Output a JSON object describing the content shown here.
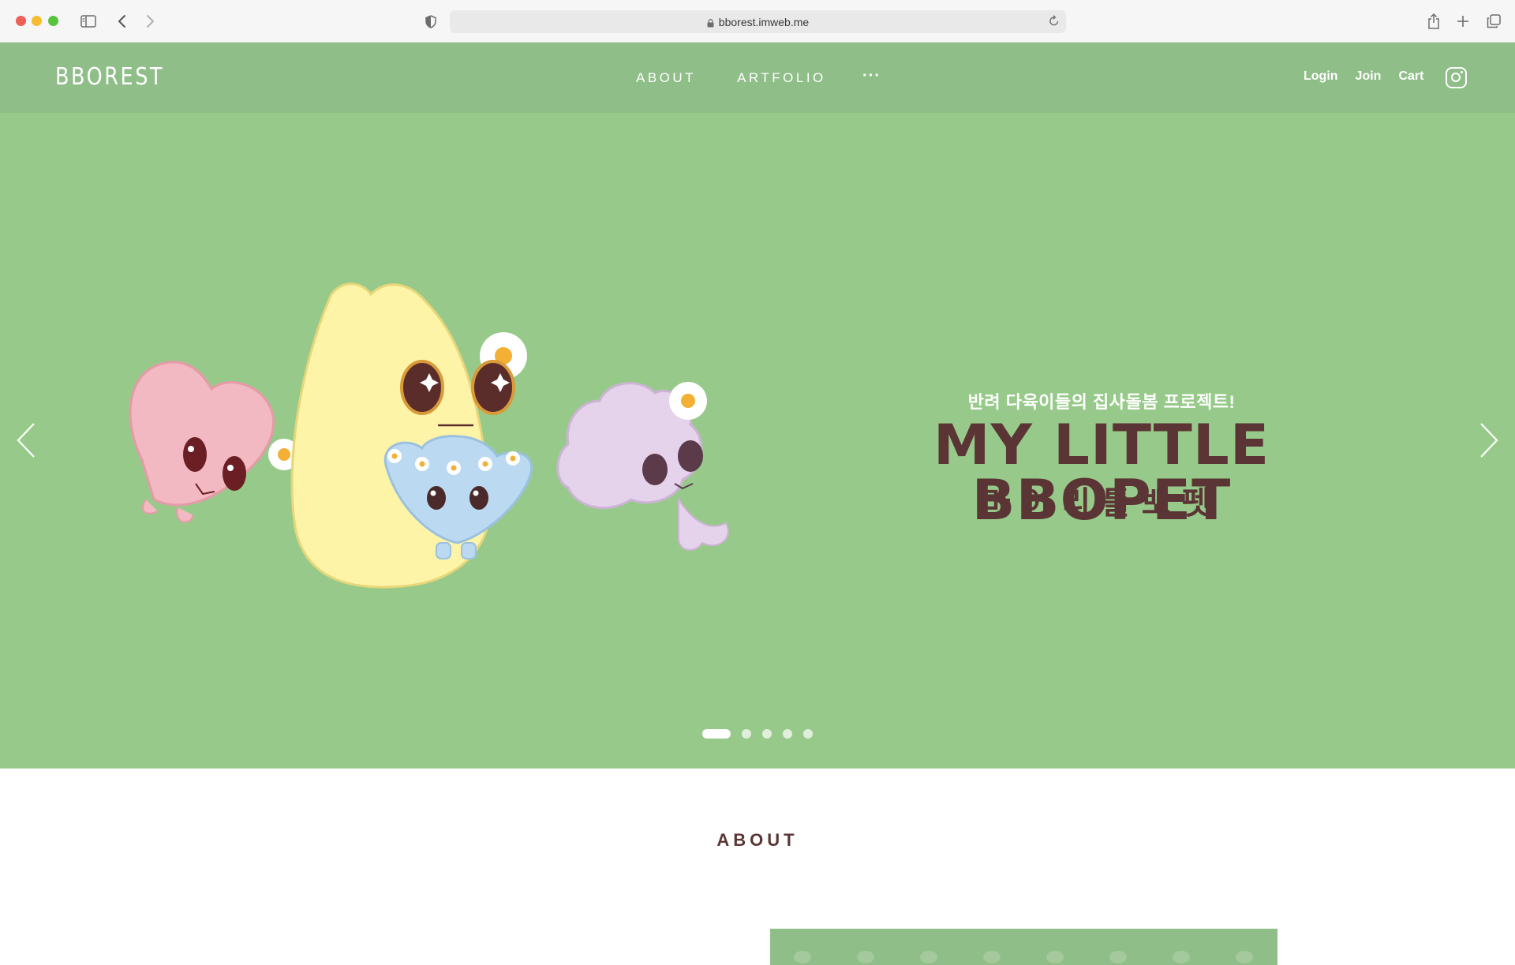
{
  "browser": {
    "url": "bborest.imweb.me"
  },
  "header": {
    "logo": "BBOREST",
    "nav": [
      "ABOUT",
      "ARTFOLIO"
    ],
    "more": "···",
    "user_links": [
      "Login",
      "Join",
      "Cart"
    ]
  },
  "hero": {
    "subtitle": "반려 다육이들의 집사돌봄 프로젝트!",
    "title": "MY LITTLE BBOPET",
    "title_kr": "마이리틀뽀펫",
    "slide_count": 5,
    "active_slide": 1,
    "background_color": "#97ca8a",
    "characters": [
      "pink-heart-character",
      "yellow-fluffy-character",
      "blue-heart-character",
      "purple-flower-character"
    ]
  },
  "about": {
    "title": "ABOUT"
  },
  "colors": {
    "header_green": "#8fbe88",
    "hero_green": "#97ca8a",
    "brown_text": "#5b3535"
  }
}
